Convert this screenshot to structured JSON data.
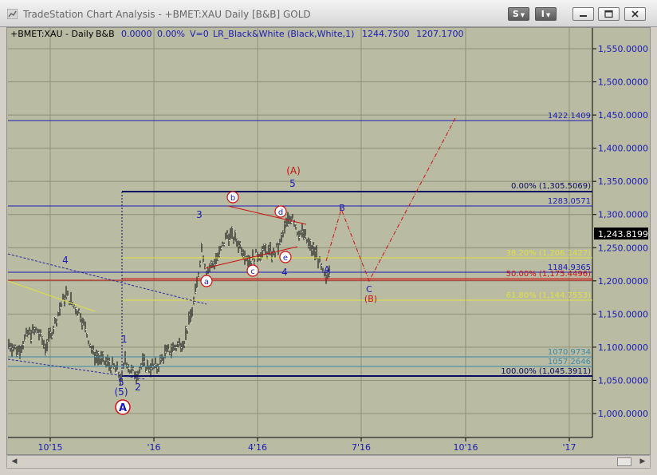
{
  "window": {
    "title": "TradeStation Chart Analysis - +BMET:XAU Daily [B&B] GOLD",
    "btn_s": "S",
    "btn_i": "I"
  },
  "status_line": {
    "symbol": "+BMET:XAU - Daily",
    "bb": "B&B",
    "change": "0.0000",
    "pct": "0.00%",
    "volume": "V=0",
    "indicator": "LR_Black&White (Black,White,1)",
    "v1": "1244.7500",
    "v2": "1207.1700"
  },
  "price_axis": [
    "1,550.0000",
    "1,500.0000",
    "1,450.0000",
    "1,400.0000",
    "1,350.0000",
    "1,300.0000",
    "1,250.0000",
    "1,200.0000",
    "1,150.0000",
    "1,100.0000",
    "1,050.0000",
    "1,000.0000"
  ],
  "last_price": "1,243.8199",
  "time_axis": [
    "10'15",
    "'16",
    "4'16",
    "7'16",
    "10'16",
    "'17"
  ],
  "levels": {
    "l1422": "1422.1409",
    "fib0": "0.00% (1,305.5069)",
    "l1283": "1283.0571",
    "fib38": "38.20% (1,206.1427)",
    "l1184": "1184.9365",
    "fib50": "50.00% (1,175.4496)",
    "fib61": "61.80% (1,144.7553)",
    "l1070": "1070.9734",
    "l1057": "1057.2646",
    "fib100": "100.00% (1,045.3911)"
  },
  "waves": {
    "w4_left": "4",
    "w1": "1",
    "w5": "5",
    "w5p": "(5)",
    "w2": "2",
    "bigA": "A",
    "w3": "3",
    "wa": "a",
    "wb": "b",
    "wc": "c",
    "wd": "d",
    "we": "e",
    "w4": "4",
    "w5top": "5",
    "bigAparen": "(A)",
    "wA": "A",
    "wB": "B",
    "wC": "C",
    "bigBparen": "(B)"
  },
  "colors": {
    "chart_bg": "#b9bba3",
    "blue_line": "#1a1ab4",
    "red": "#cc1010",
    "yellow": "#e0e040",
    "teal": "#3a8aa8",
    "navy": "#0a0a60"
  }
}
